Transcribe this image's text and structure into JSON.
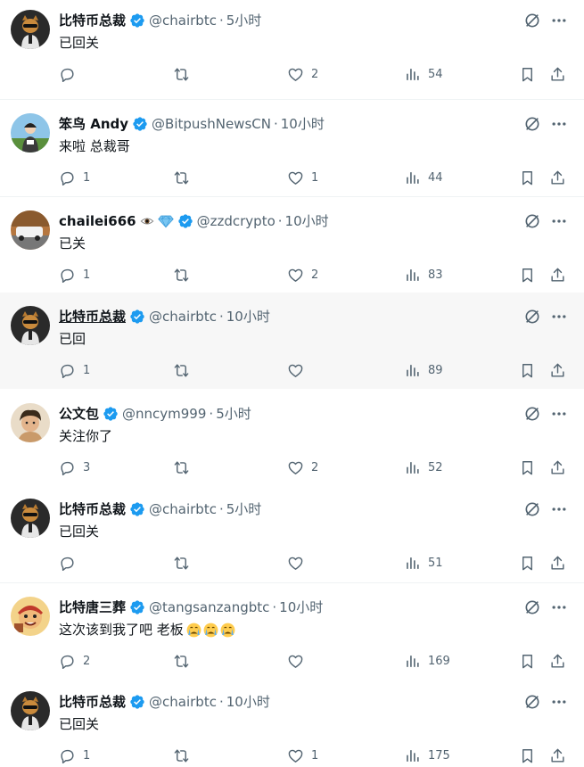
{
  "tweets": [
    {
      "author": "比特币总裁",
      "handle": "@chairbtc",
      "sep": "·",
      "time": "5小时",
      "text": "已回关",
      "replies": "",
      "likes": "2",
      "views": "54"
    },
    {
      "author": "笨鸟 Andy",
      "handle": "@BitpushNewsCN",
      "sep": "·",
      "time": "10小时",
      "text": "来啦 总裁哥",
      "replies": "1",
      "likes": "1",
      "views": "44"
    },
    {
      "author": "chailei666",
      "handle": "@zzdcrypto",
      "sep": "·",
      "time": "10小时",
      "text": "已关",
      "replies": "1",
      "likes": "2",
      "views": "83"
    },
    {
      "author": "比特币总裁",
      "handle": "@chairbtc",
      "sep": "·",
      "time": "10小时",
      "text": "已回",
      "replies": "1",
      "likes": "",
      "views": "89"
    },
    {
      "author": "公文包",
      "handle": "@nncym999",
      "sep": "·",
      "time": "5小时",
      "text": "关注你了",
      "replies": "3",
      "likes": "2",
      "views": "52"
    },
    {
      "author": "比特币总裁",
      "handle": "@chairbtc",
      "sep": "·",
      "time": "5小时",
      "text": "已回关",
      "replies": "",
      "likes": "",
      "views": "51"
    },
    {
      "author": "比特唐三葬",
      "handle": "@tangsanzangbtc",
      "sep": "·",
      "time": "10小时",
      "text": "这次该到我了吧 老板",
      "replies": "2",
      "likes": "",
      "views": "169"
    },
    {
      "author": "比特币总裁",
      "handle": "@chairbtc",
      "sep": "·",
      "time": "10小时",
      "text": "已回关",
      "replies": "1",
      "likes": "1",
      "views": "175"
    }
  ],
  "colors": {
    "verified": "#1d9bf0",
    "icon_gray": "#536471",
    "thread_line": "#cfd9de",
    "highlight_bg": "#f7f7f7"
  },
  "icons": {
    "reply": "reply-icon",
    "repost": "repost-icon",
    "like": "like-icon",
    "views": "views-icon",
    "bookmark": "bookmark-icon",
    "share": "share-icon",
    "grok": "grok-icon",
    "more": "more-icon",
    "verified": "verified-badge-icon"
  }
}
